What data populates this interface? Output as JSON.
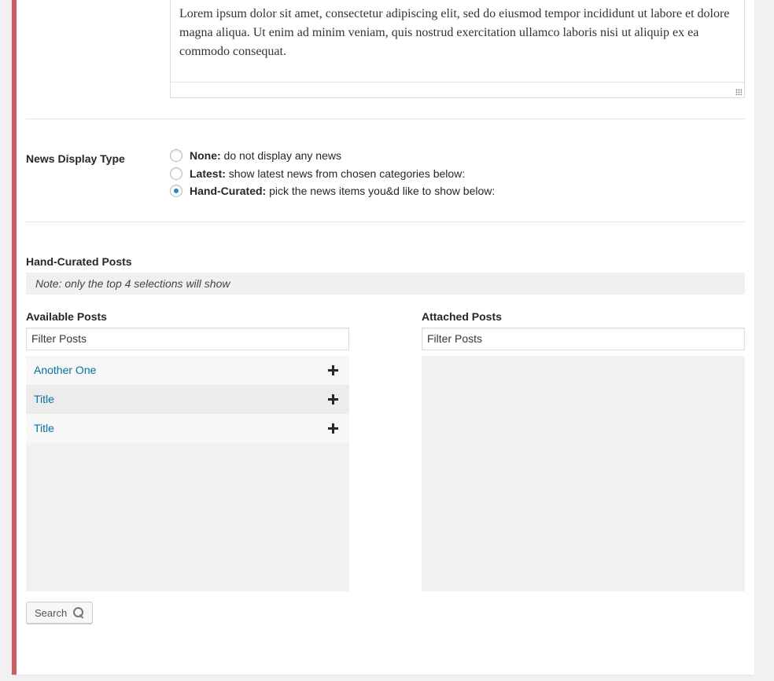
{
  "editor": {
    "text": "Lorem ipsum dolor sit amet, consectetur adipiscing elit, sed do eiusmod tempor incididunt ut labore et dolore magna aliqua. Ut enim ad minim veniam, quis nostrud exercitation ullamco laboris nisi ut aliquip ex ea commodo consequat."
  },
  "news_display": {
    "label": "News Display Type",
    "options": [
      {
        "name": "None:",
        "desc": " do not display any news",
        "checked": false
      },
      {
        "name": "Latest:",
        "desc": " show latest news from chosen categories below:",
        "checked": false
      },
      {
        "name": "Hand-Curated:",
        "desc": " pick the news items you&d like to show below:",
        "checked": true
      }
    ]
  },
  "curated": {
    "label": "Hand-Curated Posts",
    "note": "Note: only the top 4 selections will show"
  },
  "available": {
    "label": "Available Posts",
    "filter_placeholder": "Filter Posts",
    "items": [
      {
        "title": "Another One"
      },
      {
        "title": "Title"
      },
      {
        "title": "Title"
      }
    ]
  },
  "attached": {
    "label": "Attached Posts",
    "filter_placeholder": "Filter Posts",
    "items": []
  },
  "search_button": {
    "label": "Search",
    "icon": "search-icon"
  },
  "colors": {
    "accent_border": "#d15b5f",
    "link": "#0073aa",
    "radio_checked": "#1e8cbe"
  }
}
